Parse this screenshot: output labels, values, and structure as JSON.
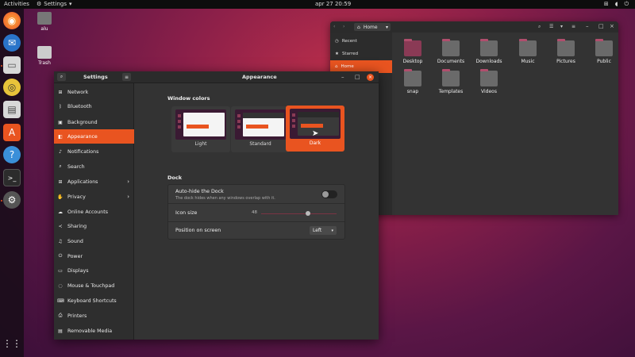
{
  "topbar": {
    "activities": "Activities",
    "app_menu": "Settings",
    "clock": "apr 27  20:59"
  },
  "desktop": {
    "icons": [
      {
        "label": "alu"
      },
      {
        "label": "Trash"
      }
    ]
  },
  "files": {
    "location": "Home",
    "sidebar": [
      {
        "label": "Recent"
      },
      {
        "label": "Starred"
      },
      {
        "label": "Home"
      }
    ],
    "items": [
      {
        "label": "Desktop"
      },
      {
        "label": "Documents"
      },
      {
        "label": "Downloads"
      },
      {
        "label": "Music"
      },
      {
        "label": "Pictures"
      },
      {
        "label": "Public"
      },
      {
        "label": "snap"
      },
      {
        "label": "Templates"
      },
      {
        "label": "Videos"
      }
    ]
  },
  "settings": {
    "sidebar_title": "Settings",
    "panel_title": "Appearance",
    "nav": [
      {
        "label": "Network"
      },
      {
        "label": "Bluetooth"
      },
      {
        "label": "Background"
      },
      {
        "label": "Appearance"
      },
      {
        "label": "Notifications"
      },
      {
        "label": "Search"
      },
      {
        "label": "Applications"
      },
      {
        "label": "Privacy"
      },
      {
        "label": "Online Accounts"
      },
      {
        "label": "Sharing"
      },
      {
        "label": "Sound"
      },
      {
        "label": "Power"
      },
      {
        "label": "Displays"
      },
      {
        "label": "Mouse & Touchpad"
      },
      {
        "label": "Keyboard Shortcuts"
      },
      {
        "label": "Printers"
      },
      {
        "label": "Removable Media"
      }
    ],
    "window_colors": {
      "title": "Window colors",
      "options": [
        {
          "label": "Light"
        },
        {
          "label": "Standard"
        },
        {
          "label": "Dark"
        }
      ],
      "selected": "Dark"
    },
    "dock": {
      "title": "Dock",
      "autohide_label": "Auto-hide the Dock",
      "autohide_sub": "The dock hides when any windows overlap with it.",
      "autohide_on": false,
      "icon_size_label": "Icon size",
      "icon_size_value": "48",
      "position_label": "Position on screen",
      "position_value": "Left"
    }
  },
  "colors": {
    "accent": "#e95420"
  }
}
